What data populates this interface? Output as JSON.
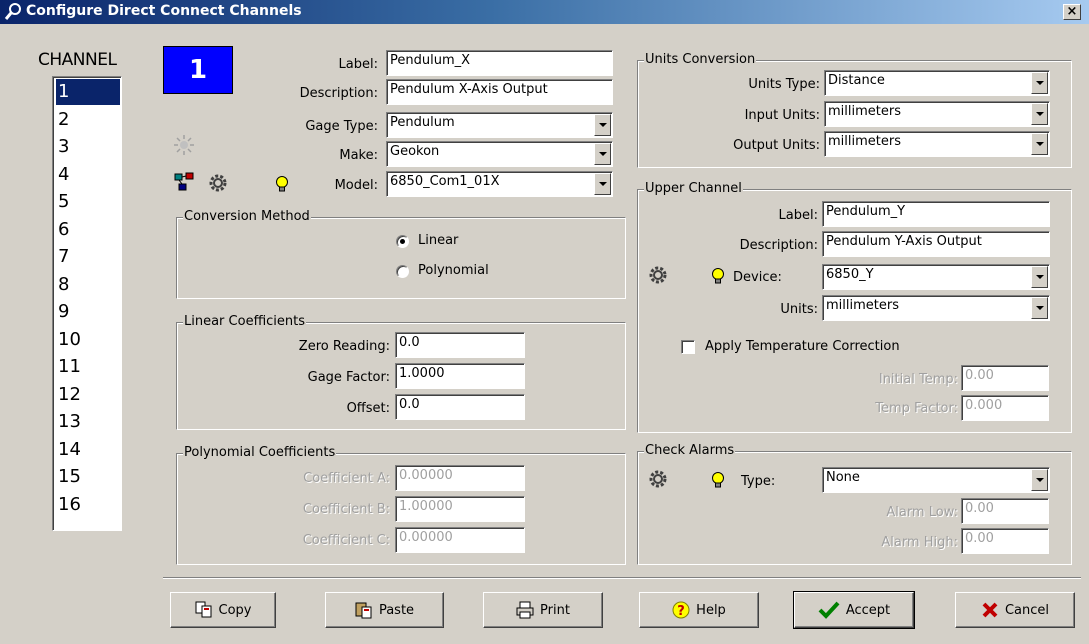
{
  "window": {
    "title": "Configure Direct Connect Channels",
    "close_label": "×"
  },
  "channels": {
    "header": "CHANNEL",
    "items": [
      "1",
      "2",
      "3",
      "4",
      "5",
      "6",
      "7",
      "8",
      "9",
      "10",
      "11",
      "12",
      "13",
      "14",
      "15",
      "16"
    ],
    "selected_index": 0,
    "current_badge": "1"
  },
  "general": {
    "label_caption": "Label:",
    "label_value": "Pendulum_X",
    "description_caption": "Description:",
    "description_value": "Pendulum X-Axis Output",
    "gage_type_caption": "Gage Type:",
    "gage_type_value": "Pendulum",
    "make_caption": "Make:",
    "make_value": "Geokon",
    "model_caption": "Model:",
    "model_value": "6850_Com1_01X"
  },
  "conversion_method": {
    "title": "Conversion Method",
    "options": [
      "Linear",
      "Polynomial"
    ],
    "selected": "Linear"
  },
  "linear_coefficients": {
    "title": "Linear Coefficients",
    "zero_caption": "Zero Reading:",
    "zero_value": "0.0",
    "factor_caption": "Gage Factor:",
    "factor_value": "1.0000",
    "offset_caption": "Offset:",
    "offset_value": "0.0"
  },
  "polynomial_coefficients": {
    "title": "Polynomial Coefficients",
    "a_caption": "Coefficient A:",
    "a_value": "0.00000",
    "b_caption": "Coefficient B:",
    "b_value": "1.00000",
    "c_caption": "Coefficient C:",
    "c_value": "0.00000"
  },
  "units_conversion": {
    "title": "Units Conversion",
    "type_caption": "Units Type:",
    "type_value": "Distance",
    "input_caption": "Input Units:",
    "input_value": "millimeters",
    "output_caption": "Output Units:",
    "output_value": "millimeters"
  },
  "upper_channel": {
    "title": "Upper Channel",
    "label_caption": "Label:",
    "label_value": "Pendulum_Y",
    "description_caption": "Description:",
    "description_value": "Pendulum Y-Axis Output",
    "device_caption": "Device:",
    "device_value": "6850_Y",
    "units_caption": "Units:",
    "units_value": "millimeters",
    "temp_correction_label": "Apply Temperature Correction",
    "temp_correction_checked": false,
    "initial_temp_caption": "Initial Temp:",
    "initial_temp_value": "0.00",
    "temp_factor_caption": "Temp Factor:",
    "temp_factor_value": "0.000"
  },
  "check_alarms": {
    "title": "Check Alarms",
    "type_caption": "Type:",
    "type_value": "None",
    "low_caption": "Alarm Low:",
    "low_value": "0.00",
    "high_caption": "Alarm High:",
    "high_value": "0.00"
  },
  "buttons": {
    "copy": "Copy",
    "paste": "Paste",
    "print": "Print",
    "help": "Help",
    "accept": "Accept",
    "cancel": "Cancel"
  },
  "colors": {
    "selection": "#0a246a",
    "badge": "#0000ff",
    "accept_check": "#008000",
    "cancel_x": "#c00000"
  }
}
